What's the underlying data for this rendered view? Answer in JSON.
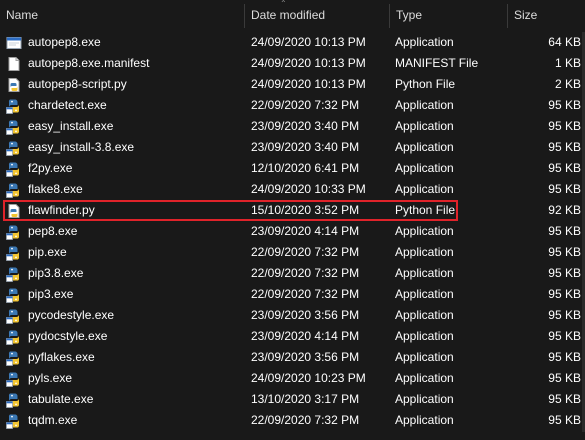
{
  "columns": {
    "name": "Name",
    "date": "Date modified",
    "type": "Type",
    "size": "Size"
  },
  "files": [
    {
      "name": "autopep8.exe",
      "date": "24/09/2020 10:13 PM",
      "type": "Application",
      "size": "64 KB",
      "icon": "exe-window-icon"
    },
    {
      "name": "autopep8.exe.manifest",
      "date": "24/09/2020 10:13 PM",
      "type": "MANIFEST File",
      "size": "1 KB",
      "icon": "document-icon"
    },
    {
      "name": "autopep8-script.py",
      "date": "24/09/2020 10:13 PM",
      "type": "Python File",
      "size": "2 KB",
      "icon": "python-file-icon"
    },
    {
      "name": "chardetect.exe",
      "date": "22/09/2020 7:32 PM",
      "type": "Application",
      "size": "95 KB",
      "icon": "python-exe-icon"
    },
    {
      "name": "easy_install.exe",
      "date": "23/09/2020 3:40 PM",
      "type": "Application",
      "size": "95 KB",
      "icon": "python-exe-icon"
    },
    {
      "name": "easy_install-3.8.exe",
      "date": "23/09/2020 3:40 PM",
      "type": "Application",
      "size": "95 KB",
      "icon": "python-exe-icon"
    },
    {
      "name": "f2py.exe",
      "date": "12/10/2020 6:41 PM",
      "type": "Application",
      "size": "95 KB",
      "icon": "python-exe-icon"
    },
    {
      "name": "flake8.exe",
      "date": "24/09/2020 10:33 PM",
      "type": "Application",
      "size": "95 KB",
      "icon": "python-exe-icon"
    },
    {
      "name": "flawfinder.py",
      "date": "15/10/2020 3:52 PM",
      "type": "Python File",
      "size": "92 KB",
      "icon": "python-file-icon",
      "selected": true
    },
    {
      "name": "pep8.exe",
      "date": "23/09/2020 4:14 PM",
      "type": "Application",
      "size": "95 KB",
      "icon": "python-exe-icon"
    },
    {
      "name": "pip.exe",
      "date": "22/09/2020 7:32 PM",
      "type": "Application",
      "size": "95 KB",
      "icon": "python-exe-icon"
    },
    {
      "name": "pip3.8.exe",
      "date": "22/09/2020 7:32 PM",
      "type": "Application",
      "size": "95 KB",
      "icon": "python-exe-icon"
    },
    {
      "name": "pip3.exe",
      "date": "22/09/2020 7:32 PM",
      "type": "Application",
      "size": "95 KB",
      "icon": "python-exe-icon"
    },
    {
      "name": "pycodestyle.exe",
      "date": "23/09/2020 3:56 PM",
      "type": "Application",
      "size": "95 KB",
      "icon": "python-exe-icon"
    },
    {
      "name": "pydocstyle.exe",
      "date": "23/09/2020 4:14 PM",
      "type": "Application",
      "size": "95 KB",
      "icon": "python-exe-icon"
    },
    {
      "name": "pyflakes.exe",
      "date": "23/09/2020 3:56 PM",
      "type": "Application",
      "size": "95 KB",
      "icon": "python-exe-icon"
    },
    {
      "name": "pyls.exe",
      "date": "24/09/2020 10:23 PM",
      "type": "Application",
      "size": "95 KB",
      "icon": "python-exe-icon"
    },
    {
      "name": "tabulate.exe",
      "date": "13/10/2020 3:17 PM",
      "type": "Application",
      "size": "95 KB",
      "icon": "python-exe-icon"
    },
    {
      "name": "tqdm.exe",
      "date": "22/09/2020 7:32 PM",
      "type": "Application",
      "size": "95 KB",
      "icon": "python-exe-icon"
    }
  ],
  "colors": {
    "background": "#191919",
    "text": "#ffffff",
    "header_text": "#dcdcdc",
    "highlight_border": "#e0232a"
  }
}
